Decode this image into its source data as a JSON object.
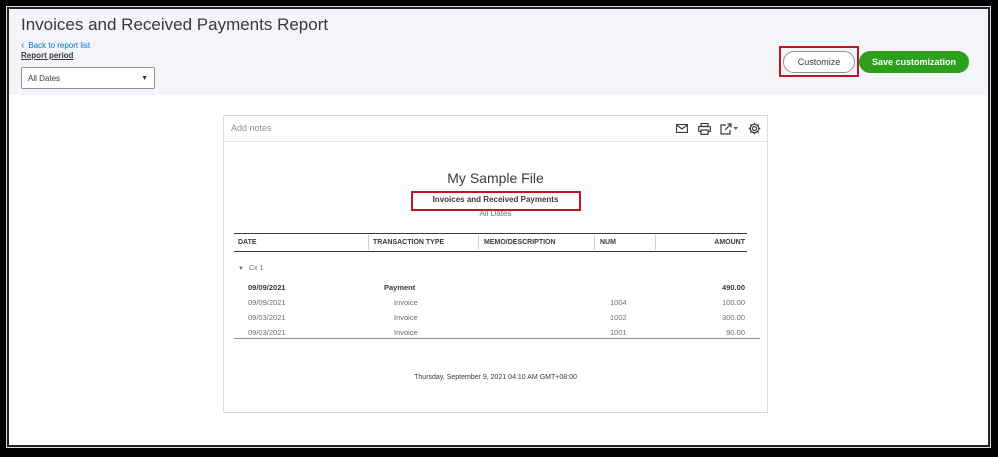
{
  "header": {
    "title": "Invoices and Received Payments Report",
    "back_link": "Back to report list",
    "report_period_label": "Report period",
    "report_period_value": "All Dates",
    "customize_label": "Customize",
    "save_customization_label": "Save customization"
  },
  "report": {
    "add_notes": "Add notes",
    "toolbar_icons": [
      "email-icon",
      "print-icon",
      "export-icon",
      "gear-icon"
    ],
    "company_name": "My Sample File",
    "report_name": "Invoices and Received Payments",
    "date_range": "All Dates",
    "columns": [
      "DATE",
      "TRANSACTION TYPE",
      "MEMO/DESCRIPTION",
      "NUM",
      "AMOUNT"
    ],
    "group_label": "Cx 1",
    "rows": [
      {
        "date": "09/09/2021",
        "type": "Payment",
        "memo": "",
        "num": "",
        "amount": "490.00"
      },
      {
        "date": "09/09/2021",
        "type": "Invoice",
        "memo": "",
        "num": "1004",
        "amount": "100.00"
      },
      {
        "date": "09/03/2021",
        "type": "Invoice",
        "memo": "",
        "num": "1002",
        "amount": "300.00"
      },
      {
        "date": "09/03/2021",
        "type": "Invoice",
        "memo": "",
        "num": "1001",
        "amount": "90.00"
      }
    ],
    "timestamp": "Thursday, September 9, 2021   04:10 AM GMT+08:00"
  },
  "colors": {
    "accent_green": "#2ca01c",
    "link_blue": "#0077c5",
    "highlight_red": "#c0161d"
  }
}
